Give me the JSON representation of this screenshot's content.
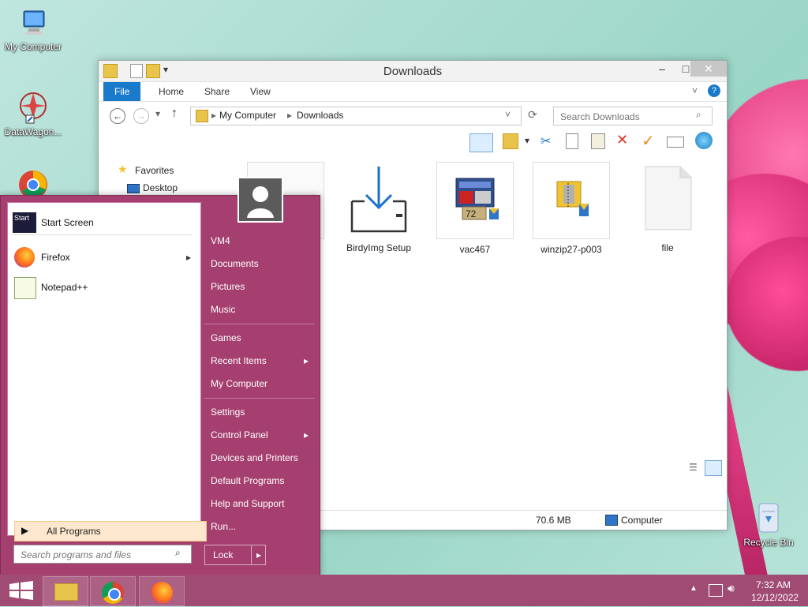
{
  "desktop": {
    "icons": [
      {
        "label": "My Computer"
      },
      {
        "label": "DataWagon..."
      },
      {
        "label": "Recycle Bin"
      }
    ]
  },
  "explorer": {
    "title": "Downloads",
    "tabs": [
      "File",
      "Home",
      "Share",
      "View"
    ],
    "breadcrumb": [
      "My Computer",
      "Downloads"
    ],
    "search_placeholder": "Search Downloads",
    "nav": {
      "favorites": "Favorites",
      "desktop": "Desktop"
    },
    "files": [
      {
        "name": "",
        "note": ""
      },
      {
        "name": "BirdyImg Setup"
      },
      {
        "name": "vac467"
      },
      {
        "name": "winzip27-p003"
      },
      {
        "name": "file"
      }
    ],
    "status": {
      "size": "70.6 MB",
      "location": "Computer"
    }
  },
  "start_menu": {
    "left_items": [
      {
        "label": "Start Screen"
      },
      {
        "label": "Firefox"
      },
      {
        "label": "Notepad++"
      }
    ],
    "all_programs": "All Programs",
    "search_placeholder": "Search programs and files",
    "right_items": [
      "VM4",
      "Documents",
      "Pictures",
      "Music",
      "Games",
      "Recent Items",
      "My Computer",
      "Settings",
      "Control Panel",
      "Devices and Printers",
      "Default Programs",
      "Help and Support",
      "Run..."
    ],
    "lock_label": "Lock"
  },
  "taskbar": {
    "clock_time": "7:32 AM",
    "clock_date": "12/12/2022"
  },
  "colors": {
    "accent": "#1979ca",
    "start_bg": "#a53f6f",
    "taskbar_bg": "#a04b73"
  }
}
